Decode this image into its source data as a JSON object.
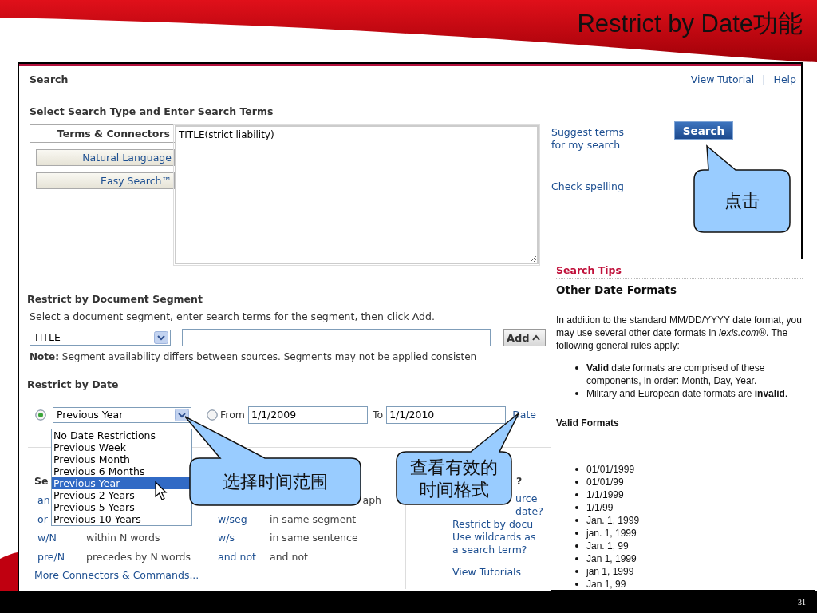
{
  "slide": {
    "title": "Restrict by Date功能",
    "page_number": "31"
  },
  "header": {
    "title": "Search",
    "links": [
      "View Tutorial",
      "Help"
    ],
    "separator": "|"
  },
  "search_type": {
    "heading": "Select Search Type and Enter Search Terms",
    "tabs": [
      {
        "label": "Terms & Connectors",
        "selected": true
      },
      {
        "label": "Natural Language",
        "selected": false
      },
      {
        "label": "Easy Search™",
        "selected": false
      }
    ],
    "query": {
      "value": "TITLE(strict liability)"
    },
    "links": [
      "Suggest terms for my search",
      "Check spelling"
    ],
    "search_button": "Search"
  },
  "segment": {
    "heading": "Restrict by Document Segment",
    "instruction": "Select a document segment, enter search terms for the segment, then click Add.",
    "select": {
      "value": "TITLE"
    },
    "add_button": "Add",
    "note": "**Note:** Segment availability differs between sources. Segments may not be applied consisten"
  },
  "date": {
    "heading": "Restrict by Date",
    "preset": {
      "selected": true,
      "value": "Previous Year"
    },
    "range": {
      "selected": false,
      "from_label": "From",
      "from": "1/1/2009",
      "to_label": "To",
      "to": "1/1/2010"
    },
    "link": "Date",
    "dropdown": {
      "items": [
        {
          "label": "No Date Restrictions",
          "selected": false
        },
        {
          "label": "Previous Week",
          "selected": false
        },
        {
          "label": "Previous Month",
          "selected": false
        },
        {
          "label": "Previous 6 Months",
          "selected": false
        },
        {
          "label": "Previous Year",
          "selected": true
        },
        {
          "label": "Previous 2 Years",
          "selected": false
        },
        {
          "label": "Previous 5 Years",
          "selected": false
        },
        {
          "label": "Previous 10 Years",
          "selected": false
        }
      ]
    }
  },
  "connectors": {
    "heading": "Se",
    "rows": [
      {
        "op1": "an",
        "desc2": "aph",
        "kind": "tail"
      },
      {
        "op1": "or",
        "op2": "w/seg",
        "desc2": "in same segment"
      },
      {
        "op1": "w/N",
        "desc1": "within N words",
        "op2": "w/s",
        "desc2": "in same sentence"
      },
      {
        "op1": "pre/N",
        "desc1": "precedes by N words",
        "op2": "and not",
        "desc2": "and not"
      }
    ],
    "more_link": "More Connectors & Commands..."
  },
  "help": {
    "heading": "?",
    "links": [
      {
        "text": "urce",
        "kind": "indent"
      },
      {
        "text": "date?",
        "kind": "indent"
      },
      {
        "text": "Restrict by docu",
        "kind": "plain"
      },
      {
        "text": "Use wildcards as",
        "kind": "plain"
      },
      {
        "text": "a search term?",
        "kind": "plain"
      },
      {
        "text": "View Tutorials",
        "kind": "spaced"
      }
    ]
  },
  "tips": {
    "label": "Search Tips",
    "title": "Other Date Formats",
    "intro": "In addition to the standard MM/DD/YYYY date format, you may use several other date formats in *lexis.com®*. The following general rules apply:",
    "rules": [
      "**Valid** date formats are comprised of these components, in order:  Month, Day, Year.",
      "Military and European date formats are **invalid**."
    ],
    "formats_heading": "Valid Formats",
    "formats": [
      "01/01/1999",
      "01/01/99",
      "1/1/1999",
      "1/1/99",
      "Jan. 1, 1999",
      "jan. 1, 1999",
      "Jan. 1, 99",
      "Jan 1, 1999",
      "jan 1, 1999",
      "Jan 1, 99"
    ]
  },
  "callouts": [
    {
      "lines": [
        "点击"
      ]
    },
    {
      "lines": [
        "选择时间范围"
      ]
    },
    {
      "lines": [
        "查看有效的",
        "时间格式"
      ]
    }
  ]
}
